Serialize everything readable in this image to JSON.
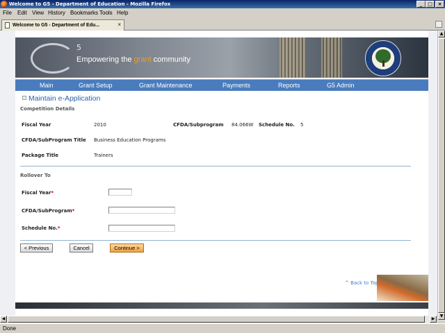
{
  "window": {
    "title": "Welcome to G5 - Department of Education - Mozilla Firefox"
  },
  "menu": [
    "File",
    "Edit",
    "View",
    "History",
    "Bookmarks",
    "Tools",
    "Help"
  ],
  "tab": {
    "label": "Welcome to G5 - Department of Edu..."
  },
  "banner": {
    "logo_sup": "5",
    "tagline_before": "Empowering the ",
    "tagline_accent": "grant",
    "tagline_after": " community"
  },
  "nav": [
    "Main",
    "Grant Setup",
    "Grant Maintenance",
    "Payments",
    "Reports",
    "G5 Admin"
  ],
  "page": {
    "title": "Maintain e-Application"
  },
  "competition": {
    "heading": "Competition Details",
    "fiscal_year_label": "Fiscal Year",
    "fiscal_year": "2010",
    "cfda_label": "CFDA/Subprogram",
    "cfda": "84.066W",
    "schedule_label": "Schedule No.",
    "schedule": "5",
    "subprogram_title_label": "CFDA/SubProgram Title",
    "subprogram_title": "Business Education Programs",
    "package_title_label": "Package Title",
    "package_title": "Trainers"
  },
  "rollover": {
    "heading": "Rollover To",
    "fiscal_year_label": "Fiscal Year",
    "cfda_label": "CFDA/SubProgram",
    "schedule_label": "Schedule No.",
    "required_mark": "*",
    "fiscal_year_value": "",
    "cfda_value": "",
    "schedule_value": ""
  },
  "buttons": {
    "previous": "< Previous",
    "cancel": "Cancel",
    "continue": "Continue >"
  },
  "footer": {
    "back_to_top": "^ Back to Top"
  },
  "status": {
    "text": "Done"
  },
  "colors": {
    "nav": "#4a7cbd",
    "title": "#2c5fa8",
    "accent": "#f39a1c",
    "required": "#cc0000"
  }
}
